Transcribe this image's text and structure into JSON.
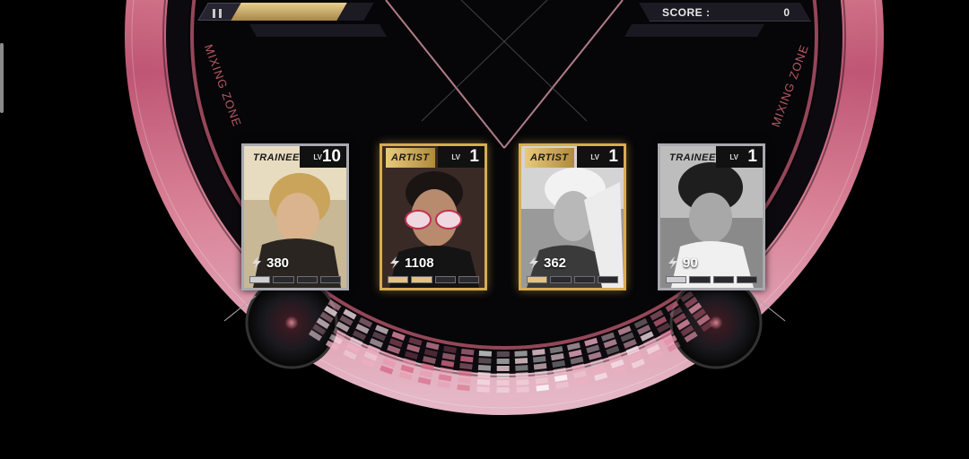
{
  "hud": {
    "pause_icon": "pause-icon",
    "progress_percent": 80,
    "score_label": "SCORE :",
    "score_value": "0"
  },
  "zone": {
    "left_label": "MIXING ZONE",
    "right_label": "MIXING ZONE"
  },
  "cards": [
    {
      "rank": "TRAINEE",
      "level_label": "LV",
      "level": "10",
      "power": "380",
      "frame": "silver"
    },
    {
      "rank": "ARTIST",
      "level_label": "LV",
      "level": "1",
      "power": "1108",
      "frame": "gold"
    },
    {
      "rank": "ARTIST",
      "level_label": "LV",
      "level": "1",
      "power": "362",
      "frame": "gold"
    },
    {
      "rank": "TRAINEE",
      "level_label": "LV",
      "level": "1",
      "power": "90",
      "frame": "silver"
    }
  ],
  "colors": {
    "gold_frame": "#d6ad4e",
    "silver_frame": "#a9a9b0",
    "disc_pink": "#e88aa0",
    "disc_orange": "#f2b060",
    "disc_cyan": "#a8e4ee",
    "background": "#000000"
  }
}
